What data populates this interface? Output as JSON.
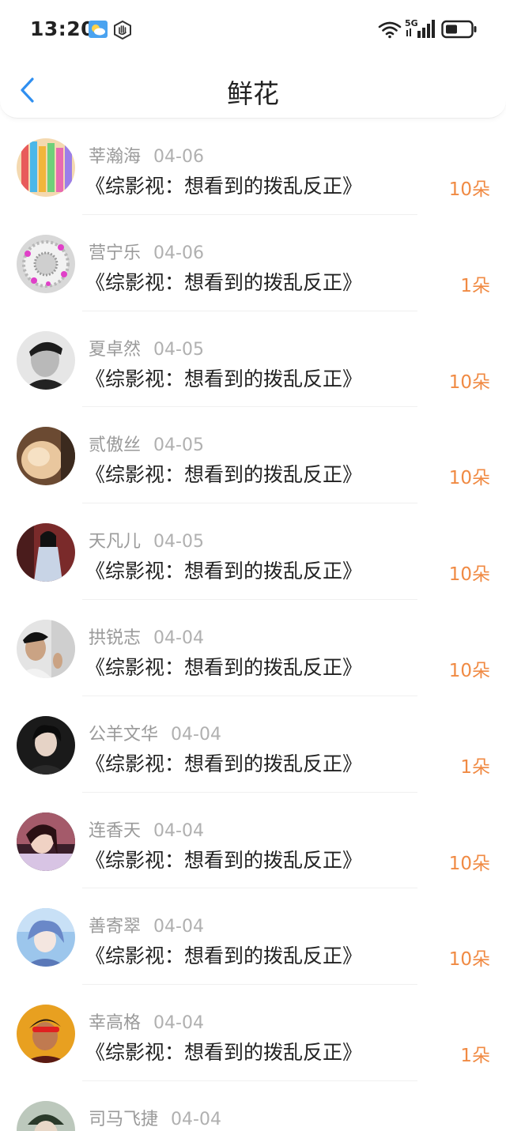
{
  "status_bar": {
    "time": "13:20",
    "network": "5G",
    "icons": [
      "weather-sun-cloud-icon",
      "hand-stop-icon",
      "wifi-icon",
      "cell-signal-icon",
      "battery-icon"
    ]
  },
  "header": {
    "title": "鲜花",
    "back_icon": "chevron-left-icon"
  },
  "colors": {
    "accent_blue": "#2f8ff0",
    "flower_count_orange": "#f08a43",
    "secondary_text": "#9a9a9a"
  },
  "items": [
    {
      "name": "莘瀚海",
      "date": "04-06",
      "title": "《综影视：想看到的拨乱反正》",
      "count": "10朵"
    },
    {
      "name": "营宁乐",
      "date": "04-06",
      "title": "《综影视：想看到的拨乱反正》",
      "count": "1朵"
    },
    {
      "name": "夏卓然",
      "date": "04-05",
      "title": "《综影视：想看到的拨乱反正》",
      "count": "10朵"
    },
    {
      "name": "贰傲丝",
      "date": "04-05",
      "title": "《综影视：想看到的拨乱反正》",
      "count": "10朵"
    },
    {
      "name": "天凡儿",
      "date": "04-05",
      "title": "《综影视：想看到的拨乱反正》",
      "count": "10朵"
    },
    {
      "name": "拱锐志",
      "date": "04-04",
      "title": "《综影视：想看到的拨乱反正》",
      "count": "10朵"
    },
    {
      "name": "公羊文华",
      "date": "04-04",
      "title": "《综影视：想看到的拨乱反正》",
      "count": "1朵"
    },
    {
      "name": "连香天",
      "date": "04-04",
      "title": "《综影视：想看到的拨乱反正》",
      "count": "10朵"
    },
    {
      "name": "善寄翠",
      "date": "04-04",
      "title": "《综影视：想看到的拨乱反正》",
      "count": "10朵"
    },
    {
      "name": "幸高格",
      "date": "04-04",
      "title": "《综影视：想看到的拨乱反正》",
      "count": "1朵"
    },
    {
      "name": "司马飞捷",
      "date": "04-04",
      "title": "",
      "count": ""
    }
  ]
}
